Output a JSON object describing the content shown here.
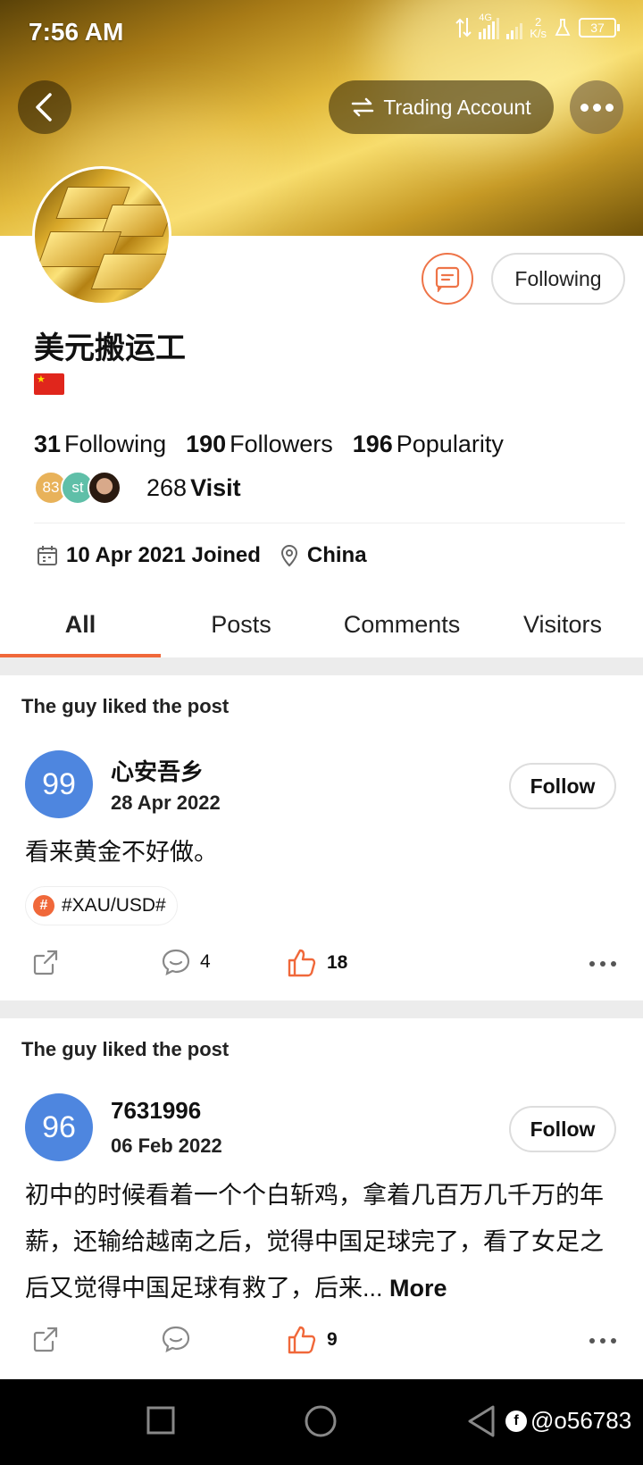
{
  "status_bar": {
    "time": "7:56 AM",
    "network": "4G",
    "speed_value": "2",
    "speed_unit": "K/s",
    "battery": "37"
  },
  "header": {
    "trading_account_label": "Trading Account"
  },
  "profile": {
    "name": "美元搬运工",
    "message_button": "message",
    "following_button": "Following",
    "stats": {
      "following_count": "31",
      "following_label": "Following",
      "followers_count": "190",
      "followers_label": "Followers",
      "popularity_count": "196",
      "popularity_label": "Popularity"
    },
    "visitors": {
      "avatar1": "83",
      "avatar2": "st",
      "count": "268",
      "label": "Visit"
    },
    "joined": "10 Apr 2021 Joined",
    "location": "China"
  },
  "tabs": [
    "All",
    "Posts",
    "Comments",
    "Visitors"
  ],
  "feed": [
    {
      "liked_label": "The guy liked the post",
      "avatar_text": "99",
      "name": "心安吾乡",
      "date": "28 Apr 2022",
      "follow_label": "Follow",
      "text": "看来黄金不好做。",
      "tag": "#XAU/USD#",
      "comments": "4",
      "likes": "18"
    },
    {
      "liked_label": "The guy liked the post",
      "avatar_text": "96",
      "name": "7631996",
      "date": "06 Feb 2022",
      "follow_label": "Follow",
      "text": "初中的时候看着一个个白斩鸡，拿着几百万几千万的年薪，还输给越南之后，觉得中国足球完了，看了女足之后又觉得中国足球有救了，后来...",
      "more_label": "More",
      "comments": "",
      "likes": "9"
    }
  ],
  "watermark": "@o56783",
  "colors": {
    "accent": "#f0683a",
    "avatar_blue": "#4e86df"
  }
}
